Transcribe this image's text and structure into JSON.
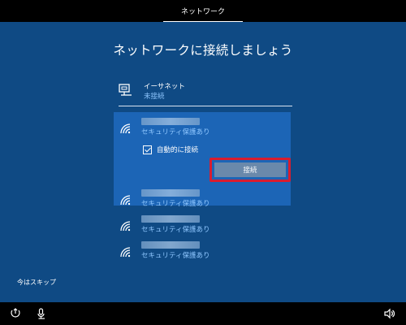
{
  "window": {
    "tab_label": "ネットワーク"
  },
  "main": {
    "title": "ネットワークに接続しましょう",
    "ethernet": {
      "name": "イーサネット",
      "status": "未接続",
      "icon": "ethernet-icon"
    },
    "wifi_networks": [
      {
        "security": "セキュリティ保護あり",
        "selected": true,
        "auto_connect_label": "自動的に接続",
        "auto_connect_checked": true,
        "connect_label": "接続"
      },
      {
        "security": "セキュリティ保護あり",
        "selected": false
      },
      {
        "security": "セキュリティ保護あり",
        "selected": false
      },
      {
        "security": "セキュリティ保護あり",
        "selected": false
      }
    ],
    "skip_label": "今はスキップ"
  },
  "taskbar": {
    "icons": [
      "accessibility-icon",
      "microphone-icon",
      "speaker-icon"
    ]
  },
  "colors": {
    "background": "#0f4a84",
    "selected": "#1c65b6",
    "accent_text": "#8fc7ff",
    "highlight_border": "#d81d2f"
  }
}
